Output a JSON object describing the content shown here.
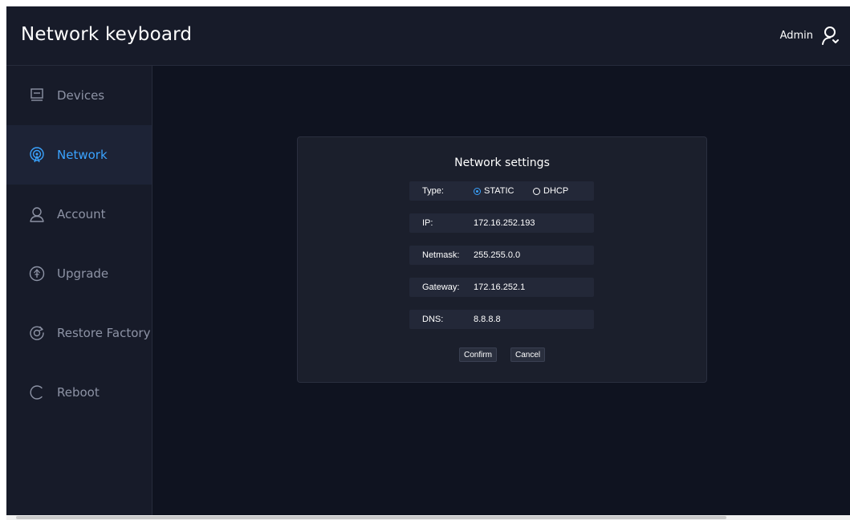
{
  "header": {
    "title": "Network keyboard",
    "user": "Admin",
    "user_icon": "user-icon"
  },
  "sidebar": {
    "active": "Network",
    "items": [
      {
        "label": "Devices",
        "icon": "devices-icon"
      },
      {
        "label": "Network",
        "icon": "network-icon"
      },
      {
        "label": "Account",
        "icon": "account-icon"
      },
      {
        "label": "Upgrade",
        "icon": "upgrade-icon"
      },
      {
        "label": "Restore Factory",
        "icon": "restore-factory-icon"
      },
      {
        "label": "Reboot",
        "icon": "reboot-icon"
      }
    ]
  },
  "dialog": {
    "title": "Network settings",
    "type": {
      "label": "Type:",
      "options": [
        "STATIC",
        "DHCP"
      ],
      "selected": "STATIC"
    },
    "ip": {
      "label": "IP:",
      "value": "172.16.252.193"
    },
    "netmask": {
      "label": "Netmask:",
      "value": "255.255.0.0"
    },
    "gateway": {
      "label": "Gateway:",
      "value": "172.16.252.1"
    },
    "dns": {
      "label": "DNS:",
      "value": "8.8.8.8"
    },
    "confirm_label": "Confirm",
    "cancel_label": "Cancel"
  },
  "colors": {
    "background": "#0f1320",
    "panel": "#171b29",
    "accent": "#3aa3ff",
    "text_muted": "#8d93a5"
  }
}
